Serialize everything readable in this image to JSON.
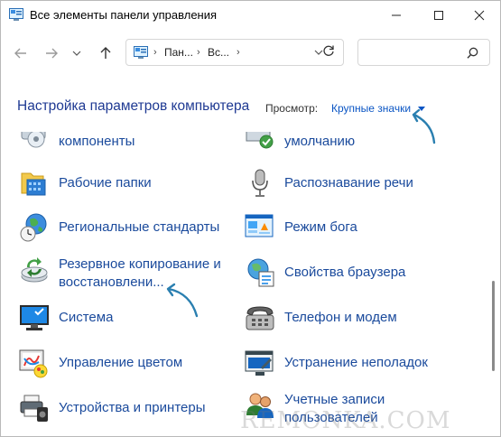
{
  "window": {
    "title": "Все элементы панели управления",
    "minimize_icon": "minimize-icon",
    "maximize_icon": "maximize-icon",
    "close_icon": "close-icon"
  },
  "nav": {
    "crumbs": [
      "Пан...",
      "Вс..."
    ]
  },
  "header": {
    "title": "Настройка параметров компьютера",
    "view_label": "Просмотр:",
    "view_value": "Крупные значки"
  },
  "items": {
    "left": [
      {
        "label": "компоненты",
        "icon": "programs-features-icon"
      },
      {
        "label": "Рабочие папки",
        "icon": "work-folders-icon"
      },
      {
        "label": "Региональные стандарты",
        "icon": "region-icon"
      },
      {
        "label_line1": "Резервное копирование и",
        "label_line2": "восстановлени...",
        "icon": "backup-restore-icon"
      },
      {
        "label": "Система",
        "icon": "system-icon"
      },
      {
        "label": "Управление цветом",
        "icon": "color-management-icon"
      },
      {
        "label": "Устройства и принтеры",
        "icon": "devices-printers-icon"
      }
    ],
    "right": [
      {
        "label": "умолчанию",
        "icon": "default-programs-icon"
      },
      {
        "label": "Распознавание речи",
        "icon": "speech-recognition-icon"
      },
      {
        "label": "Режим бога",
        "icon": "god-mode-icon"
      },
      {
        "label": "Свойства браузера",
        "icon": "internet-options-icon"
      },
      {
        "label": "Телефон и модем",
        "icon": "phone-modem-icon"
      },
      {
        "label": "Устранение неполадок",
        "icon": "troubleshooting-icon"
      },
      {
        "label_line1": "Учетные записи",
        "label_line2": "пользователей",
        "icon": "user-accounts-icon"
      }
    ]
  },
  "watermark": "REMONKA.COM",
  "colors": {
    "accent": "#0a55c4",
    "title": "#1f3a93",
    "link": "#1a4a9c",
    "arrow": "#2a7fb0"
  }
}
